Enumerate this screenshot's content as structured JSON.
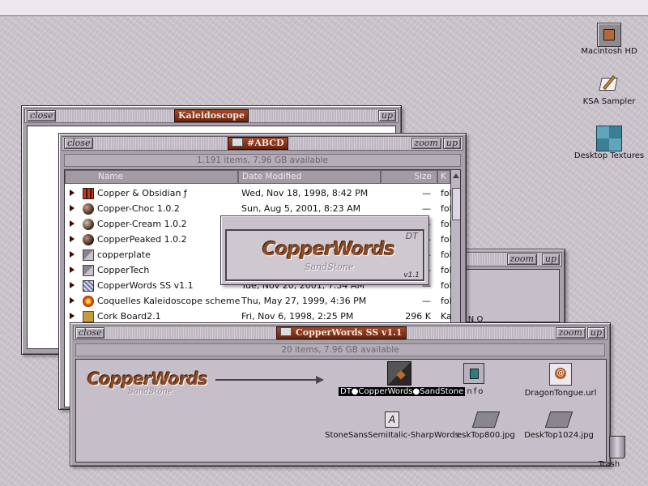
{
  "desktop": {
    "icons": [
      {
        "label": "Macintosh HD",
        "icon": "hard-disk-icon"
      },
      {
        "label": "KSA Sampler",
        "icon": "pen-document-icon"
      },
      {
        "label": "Desktop Textures",
        "icon": "texture-folder-icon"
      },
      {
        "label": "Trash",
        "icon": "trash-icon"
      }
    ]
  },
  "window_kaleidoscope": {
    "title": "Kaleidoscope",
    "close_label": "close",
    "up_label": "up"
  },
  "window_abcd": {
    "title": "#ABCD",
    "close_label": "close",
    "zoom_label": "zoom",
    "up_label": "up",
    "info": "1,191 items, 7.96 GB available",
    "columns": {
      "name": "Name",
      "date": "Date Modified",
      "size": "Size",
      "kind": "K"
    },
    "rows": [
      {
        "name": "Copper & Obsidian ƒ",
        "date": "Wed, Nov 18, 1998, 8:42 PM",
        "size": "—",
        "kind": "fol",
        "icon": "red-grid-icon"
      },
      {
        "name": "Copper-Choc 1.0.2",
        "date": "Sun, Aug 5, 2001, 8:23 AM",
        "size": "—",
        "kind": "fol",
        "icon": "sphere-icon"
      },
      {
        "name": "Copper-Cream 1.0.2",
        "date": "",
        "size": "—",
        "kind": "fol",
        "icon": "sphere-icon"
      },
      {
        "name": "CopperPeaked 1.0.2",
        "date": "",
        "size": "—",
        "kind": "fol",
        "icon": "sphere-icon"
      },
      {
        "name": "copperplate",
        "date": "",
        "size": "—",
        "kind": "fol",
        "icon": "folder-icon"
      },
      {
        "name": "CopperTech",
        "date": "",
        "size": "—",
        "kind": "fol",
        "icon": "folder-icon"
      },
      {
        "name": "CopperWords SS v1.1",
        "date": "Tue, Nov 20, 2001, 7:34 AM",
        "size": "—",
        "kind": "fol",
        "icon": "pattern-folder-icon"
      },
      {
        "name": "Coquelles Kaleidoscope scheme",
        "date": "Thu, May 27, 1999, 4:36 PM",
        "size": "—",
        "kind": "fol",
        "icon": "flower-icon"
      },
      {
        "name": "Cork Board2.1",
        "date": "Fri, Nov 6, 1998, 2:25 PM",
        "size": "296 K",
        "kind": "Ka",
        "icon": "cork-icon"
      }
    ]
  },
  "window_middle": {
    "zoom_label": "zoom",
    "up_label": "up",
    "partial_text": "M N O"
  },
  "splash": {
    "logo": "CopperWords",
    "sub": "SandStone",
    "corner": "DT",
    "version": "v1.1"
  },
  "window_ss": {
    "title": "CopperWords SS v1.1",
    "close_label": "close",
    "zoom_label": "zoom",
    "up_label": "up",
    "info": "20 items, 7.96 GB available",
    "logo": "CopperWords",
    "logo_sub": "SandStone",
    "items": [
      {
        "label": "DT●CopperWords●SandStone",
        "icon": "theme-file-icon"
      },
      {
        "label": "info",
        "icon": "info-icon"
      },
      {
        "label": "DragonTongue.url",
        "icon": "url-file-icon"
      },
      {
        "label": "StoneSansSemiItalic-SharpWords",
        "icon": "font-file-icon"
      },
      {
        "label": "eskTop800.jpg",
        "icon": "jpeg-icon"
      },
      {
        "label": "DeskTop1024.jpg",
        "icon": "jpeg-icon"
      }
    ]
  },
  "colors": {
    "accent": "#7a2e14",
    "desktop": "#c9c2ca",
    "chrome": "#a8a1aa"
  }
}
